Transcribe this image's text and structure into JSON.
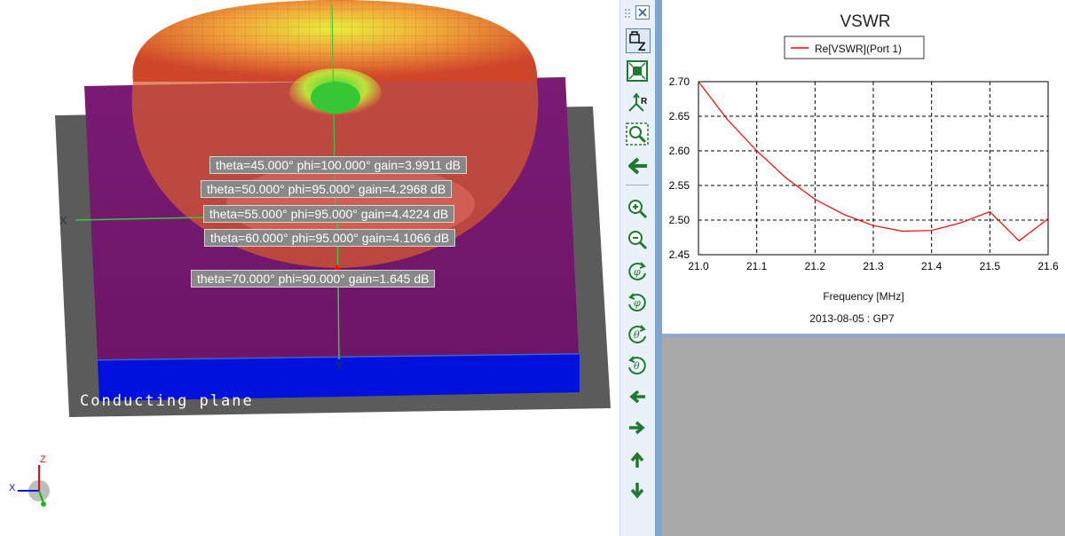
{
  "viewport": {
    "tooltips": [
      "theta=45.000° phi=100.000° gain=3.9911 dB",
      "theta=50.000° phi=95.000° gain=4.2968 dB",
      "theta=55.000° phi=95.000° gain=4.4224 dB",
      "theta=60.000° phi=95.000° gain=4.1066 dB",
      "theta=70.000° phi=90.000° gain=1.645 dB"
    ],
    "plane_label": "Conducting plane",
    "axis_x": "X",
    "axis_y": "Y",
    "triad": {
      "x": "X",
      "z": "Z"
    }
  },
  "toolbar": {
    "icons": [
      "grip-icon",
      "close-icon",
      "lock-z-icon",
      "fit-view-icon",
      "axes-r-icon",
      "zoom-box-icon",
      "back-arrow-icon",
      "zoom-in-icon",
      "zoom-out-icon",
      "rotate-phi-left-icon",
      "rotate-phi-right-icon",
      "rotate-theta-up-icon",
      "rotate-theta-down-icon",
      "pan-left-icon",
      "pan-right-icon",
      "pan-up-icon",
      "pan-down-icon"
    ]
  },
  "colors": {
    "series": "#ff0000",
    "plane_top": "#7a1b74",
    "plane_side": "#0011dd",
    "frame": "#5a5a5a",
    "toolbar_bg": "#eaf1f8"
  },
  "chart_data": {
    "type": "line",
    "title": "VSWR",
    "xlabel": "Frequency [MHz]",
    "ylabel": "",
    "footnote": "2013-08-05 : GP7",
    "xlim": [
      21.0,
      21.6
    ],
    "ylim": [
      2.45,
      2.7
    ],
    "xticks": [
      "21.0",
      "21.1",
      "21.2",
      "21.3",
      "21.4",
      "21.5",
      "21.6"
    ],
    "yticks": [
      "2.70",
      "2.65",
      "2.60",
      "2.55",
      "2.50",
      "2.45"
    ],
    "grid": true,
    "legend_position": "top",
    "series": [
      {
        "name": "Re[VSWR](Port 1)",
        "color": "#ff0000",
        "x": [
          21.0,
          21.05,
          21.1,
          21.15,
          21.2,
          21.25,
          21.3,
          21.35,
          21.4,
          21.45,
          21.5,
          21.55,
          21.6
        ],
        "y": [
          2.7,
          2.645,
          2.6,
          2.561,
          2.53,
          2.508,
          2.492,
          2.484,
          2.485,
          2.496,
          2.512,
          2.47,
          2.502
        ]
      }
    ]
  }
}
